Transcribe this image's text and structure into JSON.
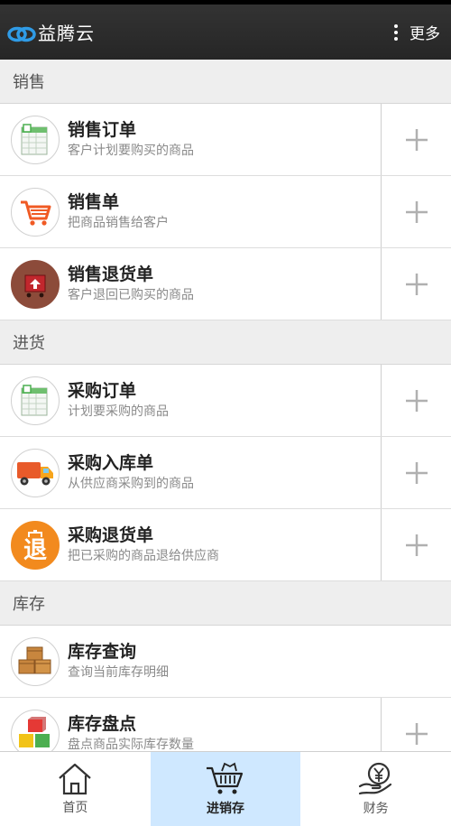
{
  "app": {
    "title": "益腾云",
    "more_label": "更多"
  },
  "sections": [
    {
      "header": "销售",
      "items": [
        {
          "title": "销售订单",
          "subtitle": "客户计划要购买的商品",
          "icon": "spreadsheet-icon"
        },
        {
          "title": "销售单",
          "subtitle": "把商品销售给客户",
          "icon": "shopping-cart-icon"
        },
        {
          "title": "销售退货单",
          "subtitle": "客户退回已购买的商品",
          "icon": "return-cart-icon"
        }
      ]
    },
    {
      "header": "进货",
      "items": [
        {
          "title": "采购订单",
          "subtitle": "计划要采购的商品",
          "icon": "spreadsheet-icon"
        },
        {
          "title": "采购入库单",
          "subtitle": "从供应商采购到的商品",
          "icon": "delivery-truck-icon"
        },
        {
          "title": "采购退货单",
          "subtitle": "把已采购的商品退给供应商",
          "icon": "return-badge-icon",
          "icon_text": "退"
        }
      ]
    },
    {
      "header": "库存",
      "items": [
        {
          "title": "库存查询",
          "subtitle": "查询当前库存明细",
          "icon": "boxes-icon"
        },
        {
          "title": "库存盘点",
          "subtitle": "盘点商品实际库存数量",
          "icon": "stacked-cubes-icon"
        }
      ]
    }
  ],
  "nav": {
    "tabs": [
      {
        "label": "首页",
        "icon": "home-icon"
      },
      {
        "label": "进销存",
        "icon": "basket-icon",
        "active": true
      },
      {
        "label": "财务",
        "icon": "yen-hand-icon"
      }
    ]
  },
  "colors": {
    "topbar": "#2c2c2c",
    "section_bg": "#eeeeee",
    "active_tab": "#cfe8ff",
    "plus": "#b0b0b0"
  }
}
